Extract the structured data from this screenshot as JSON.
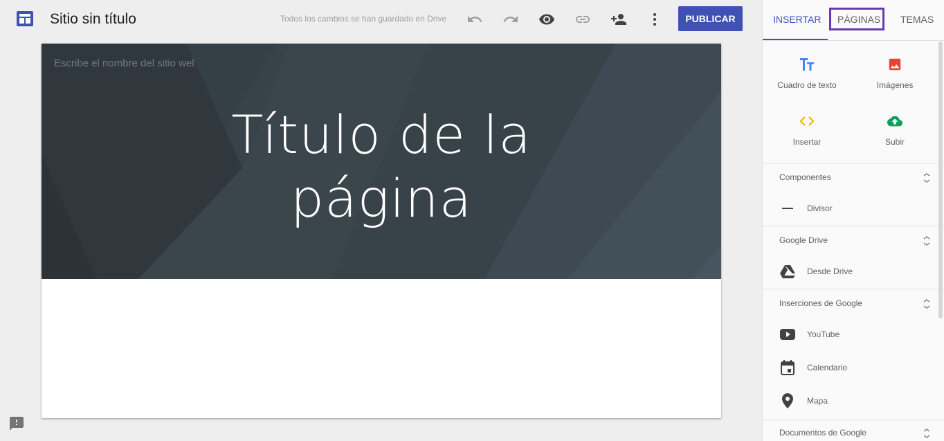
{
  "header": {
    "site_title": "Sitio sin título",
    "save_status": "Todos los cambios se han guardado en Drive",
    "publish_label": "PUBLICAR",
    "icons": [
      "site-logo-icon",
      "undo-icon",
      "redo-icon",
      "preview-icon",
      "link-icon",
      "share-icon",
      "more-icon"
    ]
  },
  "canvas": {
    "site_name_placeholder": "Escribe el nombre del sitio wel",
    "hero_title_line1": "Título de la",
    "hero_title_line2": "página"
  },
  "panel": {
    "tabs": [
      {
        "label": "INSERTAR",
        "active": true
      },
      {
        "label": "PÁGINAS",
        "highlighted": true
      },
      {
        "label": "TEMAS"
      }
    ],
    "insert_items": [
      {
        "label": "Cuadro de texto",
        "icon": "text-box-icon",
        "color": "#4285f4"
      },
      {
        "label": "Imágenes",
        "icon": "image-icon",
        "color": "#ea4335"
      },
      {
        "label": "Insertar",
        "icon": "embed-icon",
        "color": "#f4b400"
      },
      {
        "label": "Subir",
        "icon": "upload-icon",
        "color": "#0f9d58"
      }
    ],
    "sections": [
      {
        "title": "Componentes",
        "items": [
          {
            "label": "Divisor",
            "icon": "divider-icon"
          }
        ]
      },
      {
        "title": "Google Drive",
        "items": [
          {
            "label": "Desde Drive",
            "icon": "drive-icon"
          }
        ]
      },
      {
        "title": "Inserciones de Google",
        "items": [
          {
            "label": "YouTube",
            "icon": "youtube-icon"
          },
          {
            "label": "Calendario",
            "icon": "calendar-icon"
          },
          {
            "label": "Mapa",
            "icon": "map-pin-icon"
          }
        ]
      },
      {
        "title": "Documentos de Google",
        "items": []
      }
    ]
  },
  "colors": {
    "accent": "#3f51b5",
    "highlight_border": "#673ab7",
    "hero_background": "#3a444c"
  }
}
